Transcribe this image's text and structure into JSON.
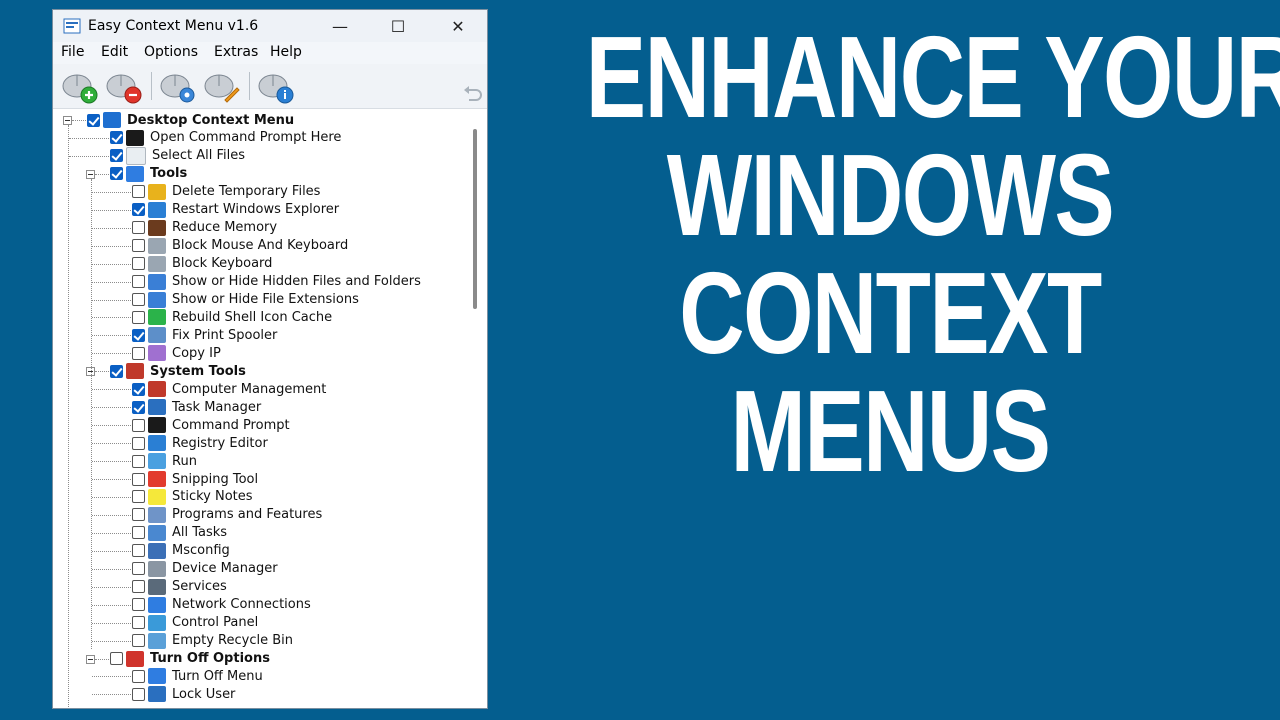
{
  "window": {
    "title": "Easy Context Menu v1.6",
    "controls": {
      "minimize": "—",
      "maximize": "☐",
      "close": "✕"
    }
  },
  "menubar": {
    "items": [
      {
        "label": "File"
      },
      {
        "label": "Edit"
      },
      {
        "label": "Options"
      },
      {
        "label": "Extras"
      },
      {
        "label": "Help"
      }
    ]
  },
  "toolbar": {
    "buttons": [
      {
        "name": "add-icon"
      },
      {
        "name": "remove-icon"
      },
      {
        "name": "settings-icon"
      },
      {
        "name": "clean-icon"
      },
      {
        "name": "info-icon"
      }
    ],
    "undo_icon": "undo-icon"
  },
  "tree": [
    {
      "label": "Desktop Context Menu",
      "checked": true,
      "bold": true,
      "level": 0,
      "icon": "monitor-icon",
      "icon_color": "#1e6fd0"
    },
    {
      "label": "Open Command Prompt Here",
      "checked": true,
      "level": 1,
      "icon": "cmd-icon",
      "icon_color": "#1a1a1a"
    },
    {
      "label": "Select All Files",
      "checked": true,
      "level": 1,
      "icon": "file-icon",
      "icon_color": "#e9eef2"
    },
    {
      "label": "Tools",
      "checked": true,
      "bold": true,
      "level": 1,
      "group": true,
      "icon": "arrow-icon",
      "icon_color": "#2f7de1"
    },
    {
      "label": "Delete Temporary Files",
      "checked": false,
      "level": 2,
      "icon": "broom-icon",
      "icon_color": "#e8b21c"
    },
    {
      "label": "Restart Windows Explorer",
      "checked": true,
      "level": 2,
      "icon": "globe-icon",
      "icon_color": "#2a7fd4"
    },
    {
      "label": "Reduce Memory",
      "checked": false,
      "level": 2,
      "icon": "memory-icon",
      "icon_color": "#6b3b1e"
    },
    {
      "label": "Block Mouse And Keyboard",
      "checked": false,
      "level": 2,
      "icon": "keyboard-icon",
      "icon_color": "#9aa6b2"
    },
    {
      "label": "Block Keyboard",
      "checked": false,
      "level": 2,
      "icon": "keyboard-icon",
      "icon_color": "#9aa6b2"
    },
    {
      "label": "Show or Hide Hidden Files and Folders",
      "checked": false,
      "level": 2,
      "icon": "folder-icon",
      "icon_color": "#3a7fd6"
    },
    {
      "label": "Show or Hide File Extensions",
      "checked": false,
      "level": 2,
      "icon": "folder-icon",
      "icon_color": "#3a7fd6"
    },
    {
      "label": "Rebuild Shell Icon Cache",
      "checked": false,
      "level": 2,
      "icon": "refresh-icon",
      "icon_color": "#2bb34a"
    },
    {
      "label": "Fix Print Spooler",
      "checked": true,
      "level": 2,
      "icon": "printer-icon",
      "icon_color": "#5d8fc9"
    },
    {
      "label": "Copy IP",
      "checked": false,
      "level": 2,
      "icon": "ip-icon",
      "icon_color": "#a070d0"
    },
    {
      "label": "System Tools",
      "checked": true,
      "bold": true,
      "level": 1,
      "group": true,
      "icon": "tools-icon",
      "icon_color": "#c0392b"
    },
    {
      "label": "Computer Management",
      "checked": true,
      "level": 2,
      "icon": "computer-icon",
      "icon_color": "#c0392b"
    },
    {
      "label": "Task Manager",
      "checked": true,
      "level": 2,
      "icon": "taskmgr-icon",
      "icon_color": "#2a6fbf"
    },
    {
      "label": "Command Prompt",
      "checked": false,
      "level": 2,
      "icon": "cmd-icon",
      "icon_color": "#1a1a1a"
    },
    {
      "label": "Registry Editor",
      "checked": false,
      "level": 2,
      "icon": "registry-icon",
      "icon_color": "#2a7fd4"
    },
    {
      "label": "Run",
      "checked": false,
      "level": 2,
      "icon": "run-icon",
      "icon_color": "#4aa0e0"
    },
    {
      "label": "Snipping Tool",
      "checked": false,
      "level": 2,
      "icon": "scissors-icon",
      "icon_color": "#e23b2e"
    },
    {
      "label": "Sticky Notes",
      "checked": false,
      "level": 2,
      "icon": "note-icon",
      "icon_color": "#f5e83a"
    },
    {
      "label": "Programs and Features",
      "checked": false,
      "level": 2,
      "icon": "programs-icon",
      "icon_color": "#6f94c8"
    },
    {
      "label": "All Tasks",
      "checked": false,
      "level": 2,
      "icon": "tasks-icon",
      "icon_color": "#4a88d0"
    },
    {
      "label": "Msconfig",
      "checked": false,
      "level": 2,
      "icon": "msconfig-icon",
      "icon_color": "#3b6fb6"
    },
    {
      "label": "Device Manager",
      "checked": false,
      "level": 2,
      "icon": "device-icon",
      "icon_color": "#8a96a3"
    },
    {
      "label": "Services",
      "checked": false,
      "level": 2,
      "icon": "services-icon",
      "icon_color": "#5a6a7a"
    },
    {
      "label": "Network Connections",
      "checked": false,
      "level": 2,
      "icon": "network-icon",
      "icon_color": "#2f7de1"
    },
    {
      "label": "Control Panel",
      "checked": false,
      "level": 2,
      "icon": "control-panel-icon",
      "icon_color": "#3a9ad9"
    },
    {
      "label": "Empty Recycle Bin",
      "checked": false,
      "level": 2,
      "icon": "recycle-bin-icon",
      "icon_color": "#5aa0d8"
    },
    {
      "label": "Turn Off Options",
      "checked": false,
      "bold": true,
      "level": 1,
      "group": true,
      "icon": "power-icon",
      "icon_color": "#d0342c"
    },
    {
      "label": "Turn Off Menu",
      "checked": false,
      "level": 2,
      "icon": "arrow-icon",
      "icon_color": "#2f7de1"
    },
    {
      "label": "Lock User",
      "checked": false,
      "level": 2,
      "icon": "lock-icon",
      "icon_color": "#2a6fbf"
    }
  ],
  "headline": {
    "lines": [
      "ENHANCE YOUR",
      "WINDOWS",
      "CONTEXT",
      "MENUS"
    ],
    "color": "#ffffff"
  },
  "colors": {
    "background": "#045e8f",
    "checkbox_checked": "#0a5fc4"
  }
}
